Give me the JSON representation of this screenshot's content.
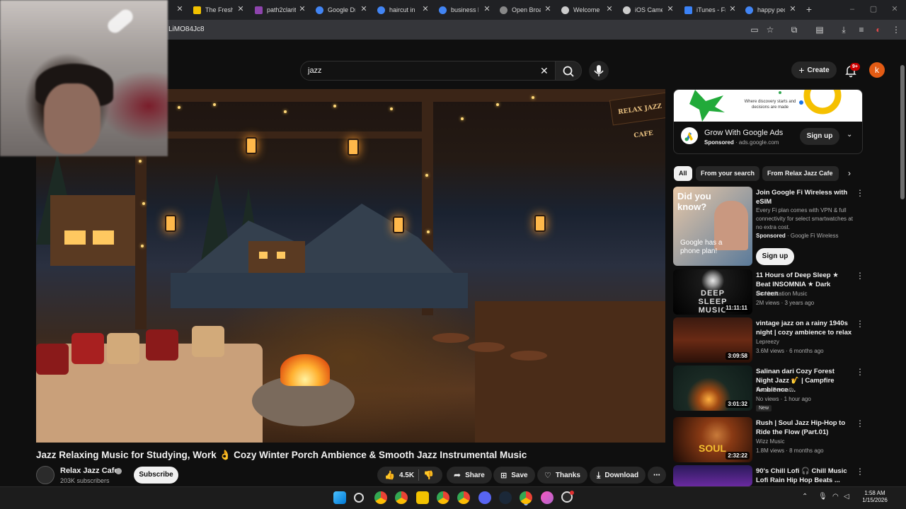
{
  "browser": {
    "tabs": [
      {
        "label": "The Fresh ",
        "color": "#f2c200"
      },
      {
        "label": "path2clarit",
        "color": "#8e44ad"
      },
      {
        "label": "Google Dri",
        "color": "#4285f4"
      },
      {
        "label": "haircut in ",
        "color": "#4285f4"
      },
      {
        "label": "business b",
        "color": "#4285f4"
      },
      {
        "label": "Open Broa",
        "color": "#888888"
      },
      {
        "label": "Welcome ",
        "color": "#cccccc"
      },
      {
        "label": "iOS Camer",
        "color": "#cccccc"
      },
      {
        "label": "iTunes - Fr",
        "color": "#3b82f6"
      },
      {
        "label": "happy pec",
        "color": "#4285f4"
      }
    ],
    "url": "LiMO84Jc8"
  },
  "masthead": {
    "search_query": "jazz",
    "create_label": "Create",
    "notification_count": "9+",
    "avatar_letter": "k"
  },
  "video": {
    "title": "Jazz Relaxing Music for Studying, Work 👌 Cozy Winter Porch Ambience & Smooth Jazz Instrumental Music",
    "sign_text": "RELAX JAZZ CAFE",
    "channel": "Relax Jazz Cafe",
    "subscribers": "203K subscribers",
    "subscribe_label": "Subscribe",
    "likes": "4.5K",
    "share_label": "Share",
    "save_label": "Save",
    "thanks_label": "Thanks",
    "download_label": "Download"
  },
  "ad": {
    "tagline": "Where discovery starts and decisions are made",
    "title": "Grow With Google Ads",
    "sponsored": "Sponsored",
    "domain": "ads.google.com",
    "signup_label": "Sign up"
  },
  "chips": [
    "All",
    "From your search",
    "From Relax Jazz Cafe"
  ],
  "recommendations": [
    {
      "title": "Join Google Fi Wireless with eSIM",
      "desc": "Every Fi plan comes with VPN & full connectivity for select smartwatches at no extra cost.",
      "sponsored": "Sponsored",
      "advertiser": "Google Fi Wireless",
      "thumb_text_top": "Did you know?",
      "thumb_text_bottom": "Google has a phone plan!",
      "signup_label": "Sign up"
    },
    {
      "title": "11 Hours of Deep Sleep ★ Beat INSOMNIA ★ Dark Screen",
      "channel": "Nu Meditation Music",
      "meta": "2M views · 3 years ago",
      "duration": "11:11:11",
      "thumb_text": "DEEP SLEEP MUSIC"
    },
    {
      "title": "vintage jazz on a rainy 1940s night | cozy ambience to relax",
      "channel": "Lepreezy",
      "meta": "3.6M views · 6 months ago",
      "duration": "3:09:58"
    },
    {
      "title": "Salinan dari Cozy Forest Night Jazz 🎷 | Campfire Ambience ...",
      "channel": "Room Beneath",
      "meta": "No views · 1 hour ago",
      "duration": "3:01:32",
      "badge": "New"
    },
    {
      "title": "Rush | Soul Jazz Hip-Hop to Ride the Flow (Part.01)",
      "channel": "Wizz Music",
      "meta": "1.8M views · 8 months ago",
      "duration": "2:32:22",
      "thumb_text": "SOUL"
    },
    {
      "title": "90's Chill Lofi 🎧 Chill Music Lofi Rain Hip Hop Beats ..."
    }
  ],
  "taskbar": {
    "time": "1:58 AM",
    "date": "1/15/2026"
  }
}
